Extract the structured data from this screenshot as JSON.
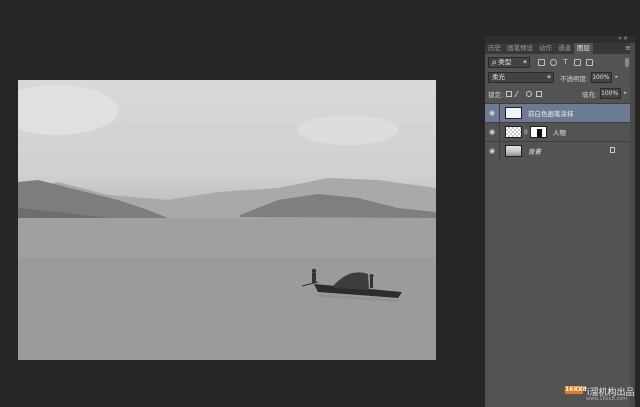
{
  "panel": {
    "collapse_icon": "double-chevron-icon",
    "tabs": [
      {
        "label": "历史"
      },
      {
        "label": "画笔预设"
      },
      {
        "label": "动作"
      },
      {
        "label": "通道"
      },
      {
        "label": "图层",
        "active": true
      }
    ],
    "menu_icon": "panel-menu-icon",
    "filter": {
      "kind_label": "ρ 类型"
    },
    "blend": {
      "mode": "柔光",
      "opacity_label": "不透明度:",
      "opacity": "100%",
      "lock_label": "锁定:",
      "fill_label": "填充:",
      "fill": "100%"
    },
    "layers": [
      {
        "name": "前白色画笔涂抹",
        "visible": true,
        "selected": true,
        "thumb": "white"
      },
      {
        "name": "人物",
        "visible": true,
        "selected": false,
        "thumb": "check",
        "has_mask": true
      },
      {
        "name": "背景",
        "visible": true,
        "selected": false,
        "thumb": "photo",
        "locked": true
      }
    ]
  },
  "watermark": {
    "logo": "16XX8",
    "text": "i溜机构出品",
    "url": "www.16xx8.com"
  },
  "colors": {
    "app_background": "#262626",
    "panel_background": "#535353",
    "selected_layer": "#6c7b93",
    "watermark_accent": "#e27c1c"
  }
}
